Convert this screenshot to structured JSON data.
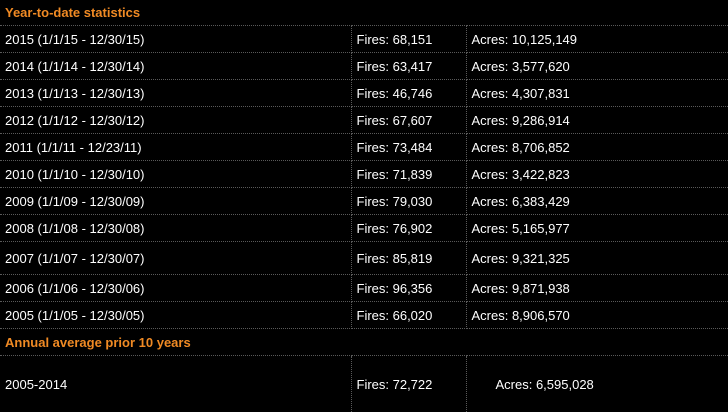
{
  "section_ytd": {
    "title": "Year-to-date statistics"
  },
  "rows": [
    {
      "period": "2015 (1/1/15 - 12/30/15)",
      "fires": "Fires: 68,151",
      "acres": "Acres: 10,125,149"
    },
    {
      "period": "2014 (1/1/14 - 12/30/14)",
      "fires": "Fires: 63,417",
      "acres": "Acres: 3,577,620"
    },
    {
      "period": "2013 (1/1/13 - 12/30/13)",
      "fires": "Fires: 46,746",
      "acres": "Acres: 4,307,831"
    },
    {
      "period": "2012 (1/1/12 - 12/30/12)",
      "fires": "Fires: 67,607",
      "acres": "Acres: 9,286,914"
    },
    {
      "period": "2011 (1/1/11 - 12/23/11)",
      "fires": "Fires: 73,484",
      "acres": "Acres: 8,706,852"
    },
    {
      "period": "2010 (1/1/10 - 12/30/10)",
      "fires": "Fires: 71,839",
      "acres": "Acres: 3,422,823"
    },
    {
      "period": "2009 (1/1/09 - 12/30/09)",
      "fires": "Fires: 79,030",
      "acres": "Acres: 6,383,429"
    },
    {
      "period": "2008 (1/1/08 - 12/30/08)",
      "fires": "Fires: 76,902",
      "acres": "Acres: 5,165,977"
    },
    {
      "period": "2007 (1/1/07 - 12/30/07)",
      "fires": "Fires: 85,819",
      "acres": "Acres: 9,321,325"
    },
    {
      "period": "2006 (1/1/06 - 12/30/06)",
      "fires": "Fires: 96,356",
      "acres": "Acres: 9,871,938"
    },
    {
      "period": "2005 (1/1/05 - 12/30/05)",
      "fires": "Fires: 66,020",
      "acres": "Acres: 8,906,570"
    }
  ],
  "section_avg": {
    "title": "Annual average prior 10 years"
  },
  "average": {
    "period": "2005-2014",
    "fires": "Fires: 72,722",
    "acres": "Acres: 6,595,028"
  },
  "colors": {
    "background": "#000000",
    "text": "#ffffff",
    "heading_accent": "#f08a24",
    "divider": "#5a5a5a"
  }
}
